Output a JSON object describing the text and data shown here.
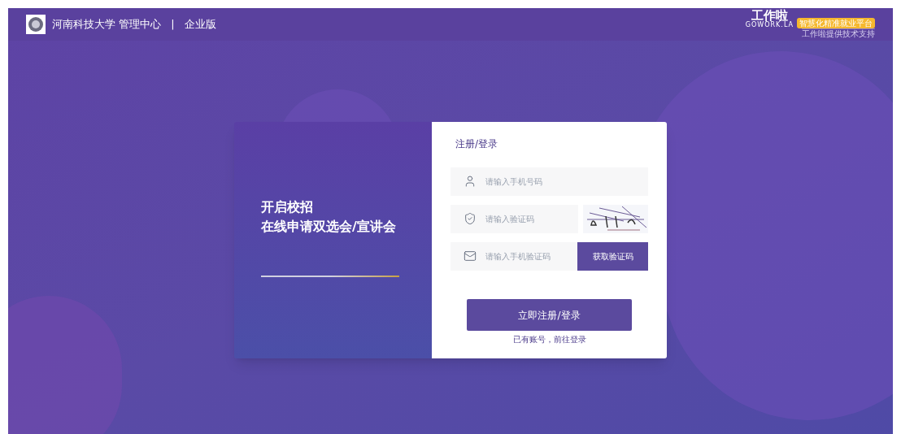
{
  "header": {
    "school": "河南科技大学 管理中心",
    "separator": "|",
    "edition": "企业版",
    "brand": {
      "name": "工作啦",
      "domain": "GOWORK.LA",
      "tagline": "智慧化精准就业平台",
      "support": "工作啦提供技术支持"
    }
  },
  "promo": {
    "lines": [
      "开启校招",
      "在线申请双选会/宣讲会"
    ]
  },
  "form": {
    "title": "注册/登录",
    "fields": [
      {
        "kind": "phone",
        "placeholder": "请输入手机号码"
      },
      {
        "kind": "captcha",
        "placeholder": "请输入验证码"
      },
      {
        "kind": "sms",
        "placeholder": "请输入手机验证码",
        "button": "获取验证码"
      }
    ],
    "submit": "立即注册/登录",
    "login_link": "已有账号，前往登录"
  }
}
